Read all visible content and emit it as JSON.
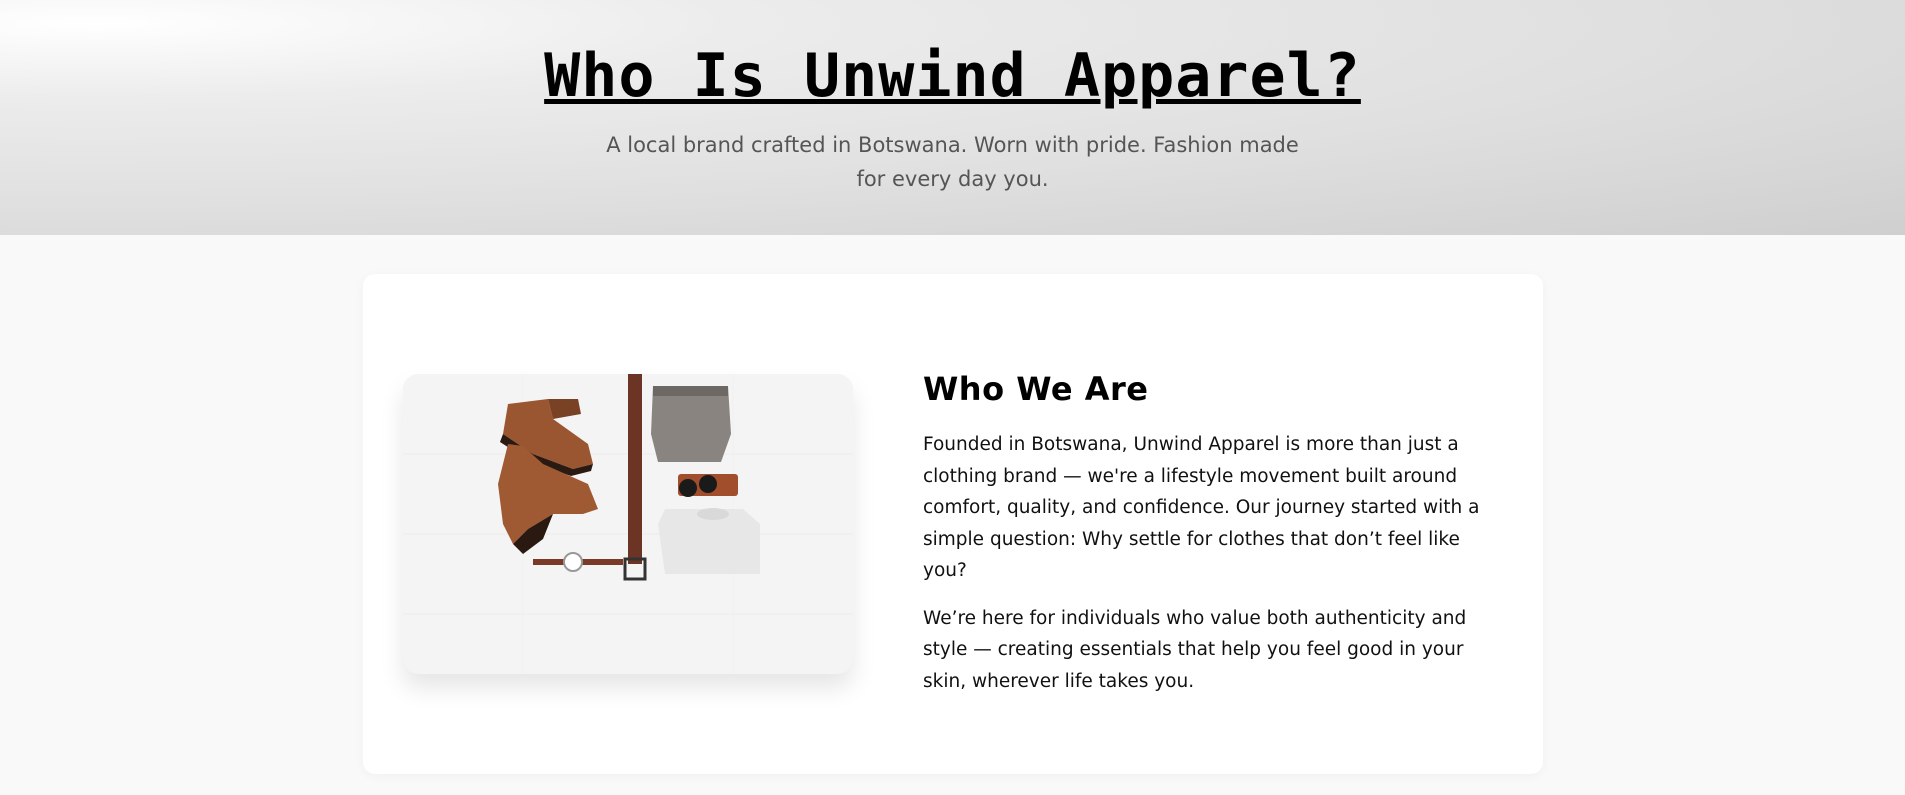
{
  "hero": {
    "title": "Who Is Unwind Apparel?",
    "subtitle": "A local brand crafted in Botswana. Worn with pride. Fashion made for every day you."
  },
  "about": {
    "heading": "Who We Are",
    "paragraphs": [
      "Founded in Botswana, Unwind Apparel is more than just a clothing brand — we're a lifestyle movement built around comfort, quality, and confidence. Our journey started with a simple question: Why settle for clothes that don’t feel like you?",
      "We’re here for individuals who value both authenticity and style — creating essentials that help you feel good in your skin, wherever life takes you."
    ],
    "image": {
      "subject": "flat-lay of brown leather boots, belt, folded trousers, sunglasses, watch and white t-shirt"
    }
  },
  "colors": {
    "page_background": "#f9f9f9",
    "card_background": "#ffffff",
    "title_text": "#000000",
    "subtitle_text": "#555555",
    "body_text": "#111111"
  }
}
